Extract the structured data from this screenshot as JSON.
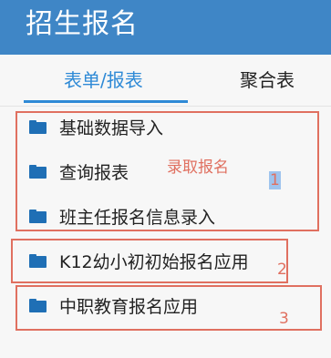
{
  "header": {
    "title": "招生报名"
  },
  "tabs": [
    {
      "label": "表单/报表",
      "active": true
    },
    {
      "label": "聚合表",
      "active": false
    }
  ],
  "items": [
    {
      "label": "基础数据导入",
      "icon": "folder-icon"
    },
    {
      "label": "查询报表",
      "icon": "folder-icon"
    },
    {
      "label": "班主任报名信息录入",
      "icon": "folder-icon"
    },
    {
      "label": "K12幼小初初始报名应用",
      "icon": "folder-icon"
    },
    {
      "label": "中职教育报名应用",
      "icon": "folder-icon"
    }
  ],
  "annotations": {
    "group1_label": "录取报名",
    "group1_number": "1",
    "group2_number": "2",
    "group3_number": "3"
  },
  "colors": {
    "header_bg": "#3f86c6",
    "active_tab": "#2f8ad6",
    "folder_icon": "#1f6fb5",
    "annotation": "#e07060",
    "highlight": "#9fc4ee"
  }
}
